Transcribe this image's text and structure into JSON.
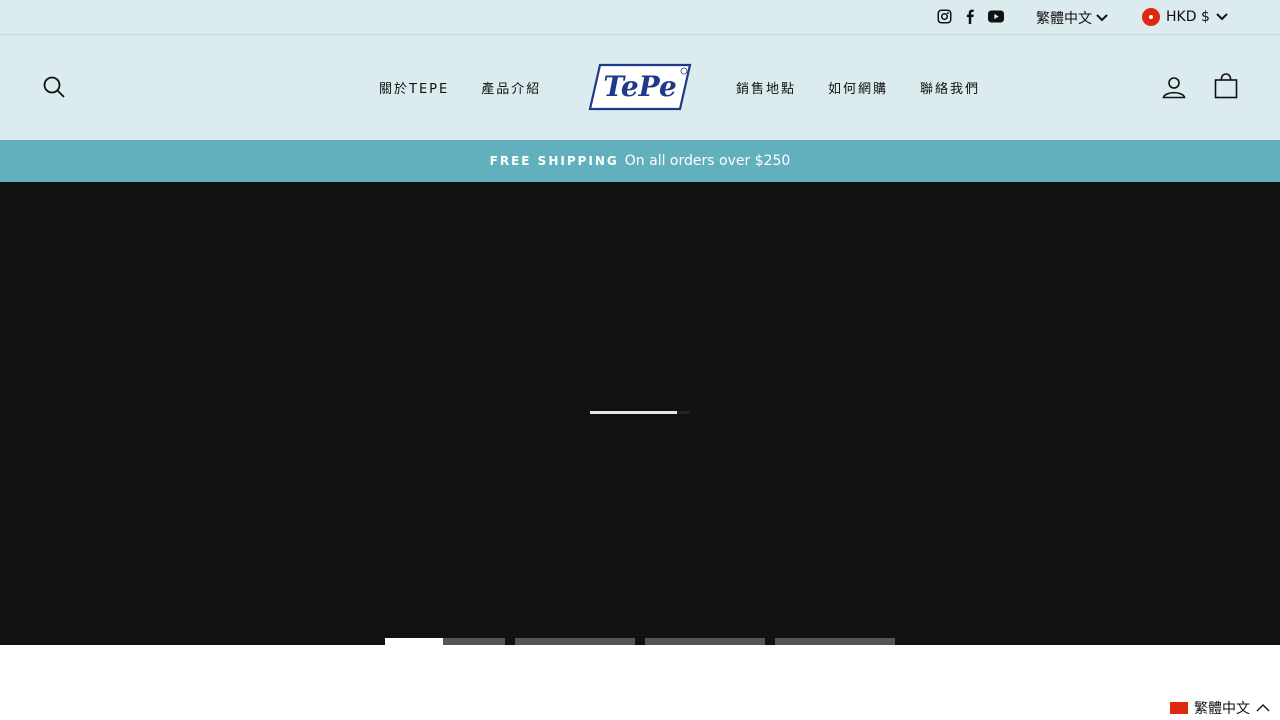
{
  "utility": {
    "social_icons": [
      "instagram-icon",
      "facebook-icon",
      "youtube-icon"
    ],
    "language": "繁體中文",
    "currency": "HKD $"
  },
  "header": {
    "nav_left": [
      "關於TEPE",
      "產品介紹"
    ],
    "nav_right": [
      "銷售地點",
      "如何網購",
      "聯絡我們"
    ],
    "logo_text": "TePe",
    "icons": [
      "search-icon",
      "account-icon",
      "cart-icon"
    ]
  },
  "announcement": {
    "strong": "FREE SHIPPING",
    "text": "On all orders over $250"
  },
  "hero": {
    "loader_progress": 0.87,
    "slides": [
      {
        "progress": 0.48
      },
      {
        "progress": 0
      },
      {
        "progress": 0
      },
      {
        "progress": 0
      }
    ]
  },
  "language_float": {
    "label": "繁體中文"
  },
  "colors": {
    "header_bg": "#dcecee",
    "announcement_bg": "#62b0be",
    "hero_bg": "#111111",
    "logo_blue": "#1f3a8a"
  }
}
